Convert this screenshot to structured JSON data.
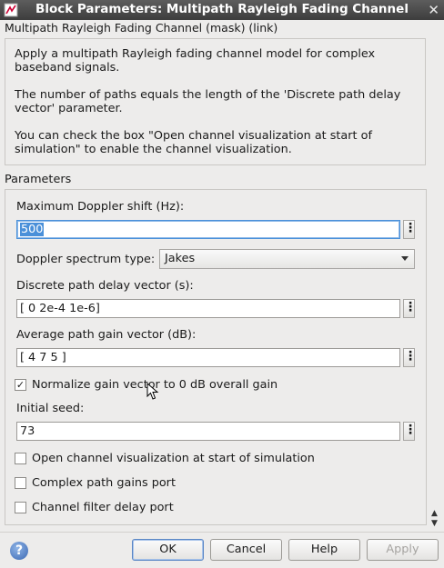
{
  "window": {
    "title": "Block Parameters: Multipath Rayleigh Fading Channel",
    "close_glyph": "✕",
    "app_icon": "simulink-block-icon"
  },
  "block": {
    "name": "Multipath Rayleigh Fading Channel (mask) (link)",
    "description": [
      "Apply a multipath Rayleigh fading channel model for complex baseband signals.",
      "The number of paths equals the length of the 'Discrete path delay vector' parameter.",
      "You can check the box \"Open channel visualization at start of simulation\" to enable the channel visualization."
    ]
  },
  "parameters": {
    "section_label": "Parameters",
    "max_doppler": {
      "label": "Maximum Doppler shift (Hz):",
      "value": "500"
    },
    "doppler_spectrum": {
      "label": "Doppler spectrum type:",
      "value": "Jakes"
    },
    "path_delay": {
      "label": "Discrete path delay vector (s):",
      "value": "[ 0 2e-4 1e-6]"
    },
    "path_gain": {
      "label": "Average path gain vector (dB):",
      "value": "[ 4 7 5 ]"
    },
    "normalize": {
      "label": "Normalize gain vector to 0 dB overall gain",
      "checked": true
    },
    "initial_seed": {
      "label": "Initial seed:",
      "value": "73"
    },
    "open_vis": {
      "label": "Open channel visualization at start of simulation",
      "checked": false
    },
    "complex_gains": {
      "label": "Complex path gains port",
      "checked": false
    },
    "filter_delay": {
      "label": "Channel filter delay port",
      "checked": false
    },
    "more_glyph": "⋮",
    "check_glyph": "✓"
  },
  "buttons": {
    "help_glyph": "?",
    "ok": "OK",
    "cancel": "Cancel",
    "help": "Help",
    "apply": "Apply"
  }
}
